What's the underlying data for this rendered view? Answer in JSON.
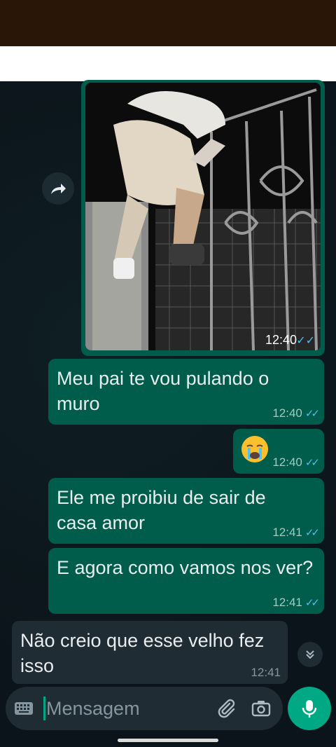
{
  "colors": {
    "chat_background": "#0b141a",
    "outgoing_bubble": "#005c4b",
    "incoming_bubble": "#202c33",
    "read_tick": "#53bdeb",
    "accent": "#00a884"
  },
  "media_message": {
    "time": "12:40",
    "status_icon": "double-check-read-icon",
    "image_icon": "photo-person-climbing-gate"
  },
  "forward_icon": "forward-arrow-icon",
  "messages": [
    {
      "direction": "out",
      "text": "Meu pai te vou pulando o muro",
      "time": "12:40",
      "status": "read"
    },
    {
      "direction": "out",
      "emoji": "crying-face-emoji",
      "time": "12:40",
      "status": "read"
    },
    {
      "direction": "out",
      "text": "Ele me proibiu de sair de casa amor",
      "time": "12:41",
      "status": "read"
    },
    {
      "direction": "out",
      "text": "E agora como vamos nos ver?",
      "time": "12:41",
      "status": "read"
    },
    {
      "direction": "in",
      "text": "Não creio que esse velho fez isso",
      "time": "12:41"
    }
  ],
  "composer": {
    "placeholder": "Mensagem",
    "keyboard_icon": "keyboard-icon",
    "attach_icon": "paperclip-icon",
    "camera_icon": "camera-icon",
    "mic_icon": "microphone-icon"
  },
  "scroll_down_icon": "double-chevron-down-icon"
}
